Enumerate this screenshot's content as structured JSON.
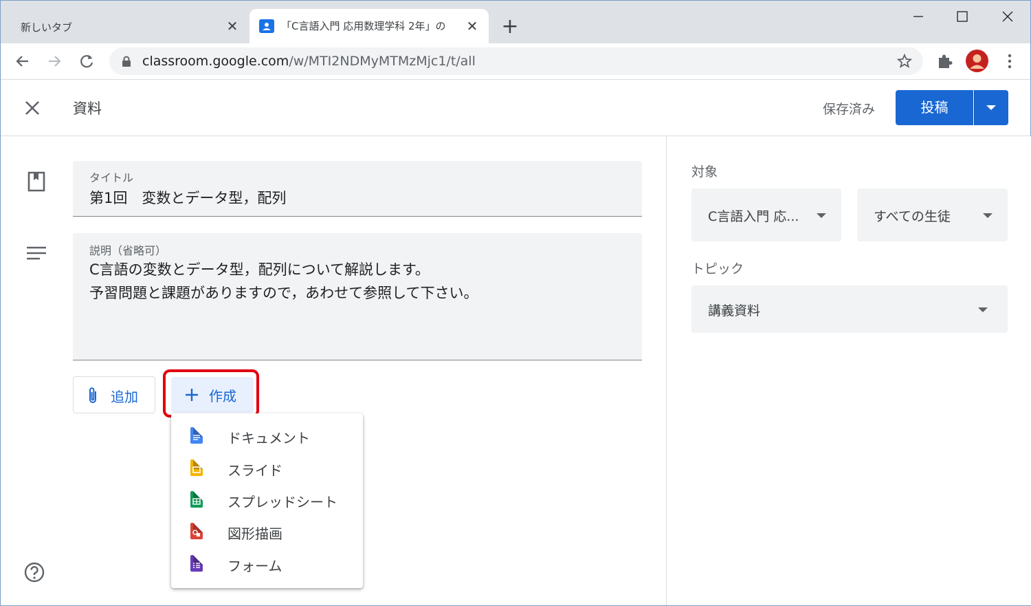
{
  "browser": {
    "tabs": [
      {
        "title": "新しいタブ"
      },
      {
        "title": "「C言語入門 応用数理学科 2年」の"
      }
    ],
    "url_host": "classroom.google.com",
    "url_path": "/w/MTI2NDMyMTMzMjc1/t/all"
  },
  "header": {
    "title": "資料",
    "saved_status": "保存済み",
    "post_label": "投稿"
  },
  "form": {
    "title_label": "タイトル",
    "title_value": "第1回　変数とデータ型，配列",
    "description_label": "説明（省略可）",
    "description_lines": [
      "C言語の変数とデータ型，配列について解説します。",
      "予習問題と課題がありますので，あわせて参照して下さい。"
    ],
    "add_label": "追加",
    "create_label": "作成"
  },
  "create_menu": {
    "items": [
      {
        "label": "ドキュメント",
        "icon": "docs-icon",
        "color": "#4285f4"
      },
      {
        "label": "スライド",
        "icon": "slides-icon",
        "color": "#f4b400"
      },
      {
        "label": "スプレッドシート",
        "icon": "sheets-icon",
        "color": "#0f9d58"
      },
      {
        "label": "図形描画",
        "icon": "drawings-icon",
        "color": "#db4437"
      },
      {
        "label": "フォーム",
        "icon": "forms-icon",
        "color": "#673ab7"
      }
    ]
  },
  "sidebar": {
    "target_label": "対象",
    "class_value": "C言語入門 応...",
    "students_value": "すべての生徒",
    "topic_label": "トピック",
    "topic_value": "講義資料"
  },
  "colors": {
    "accent": "#1967d2",
    "highlight": "#e0000f"
  }
}
